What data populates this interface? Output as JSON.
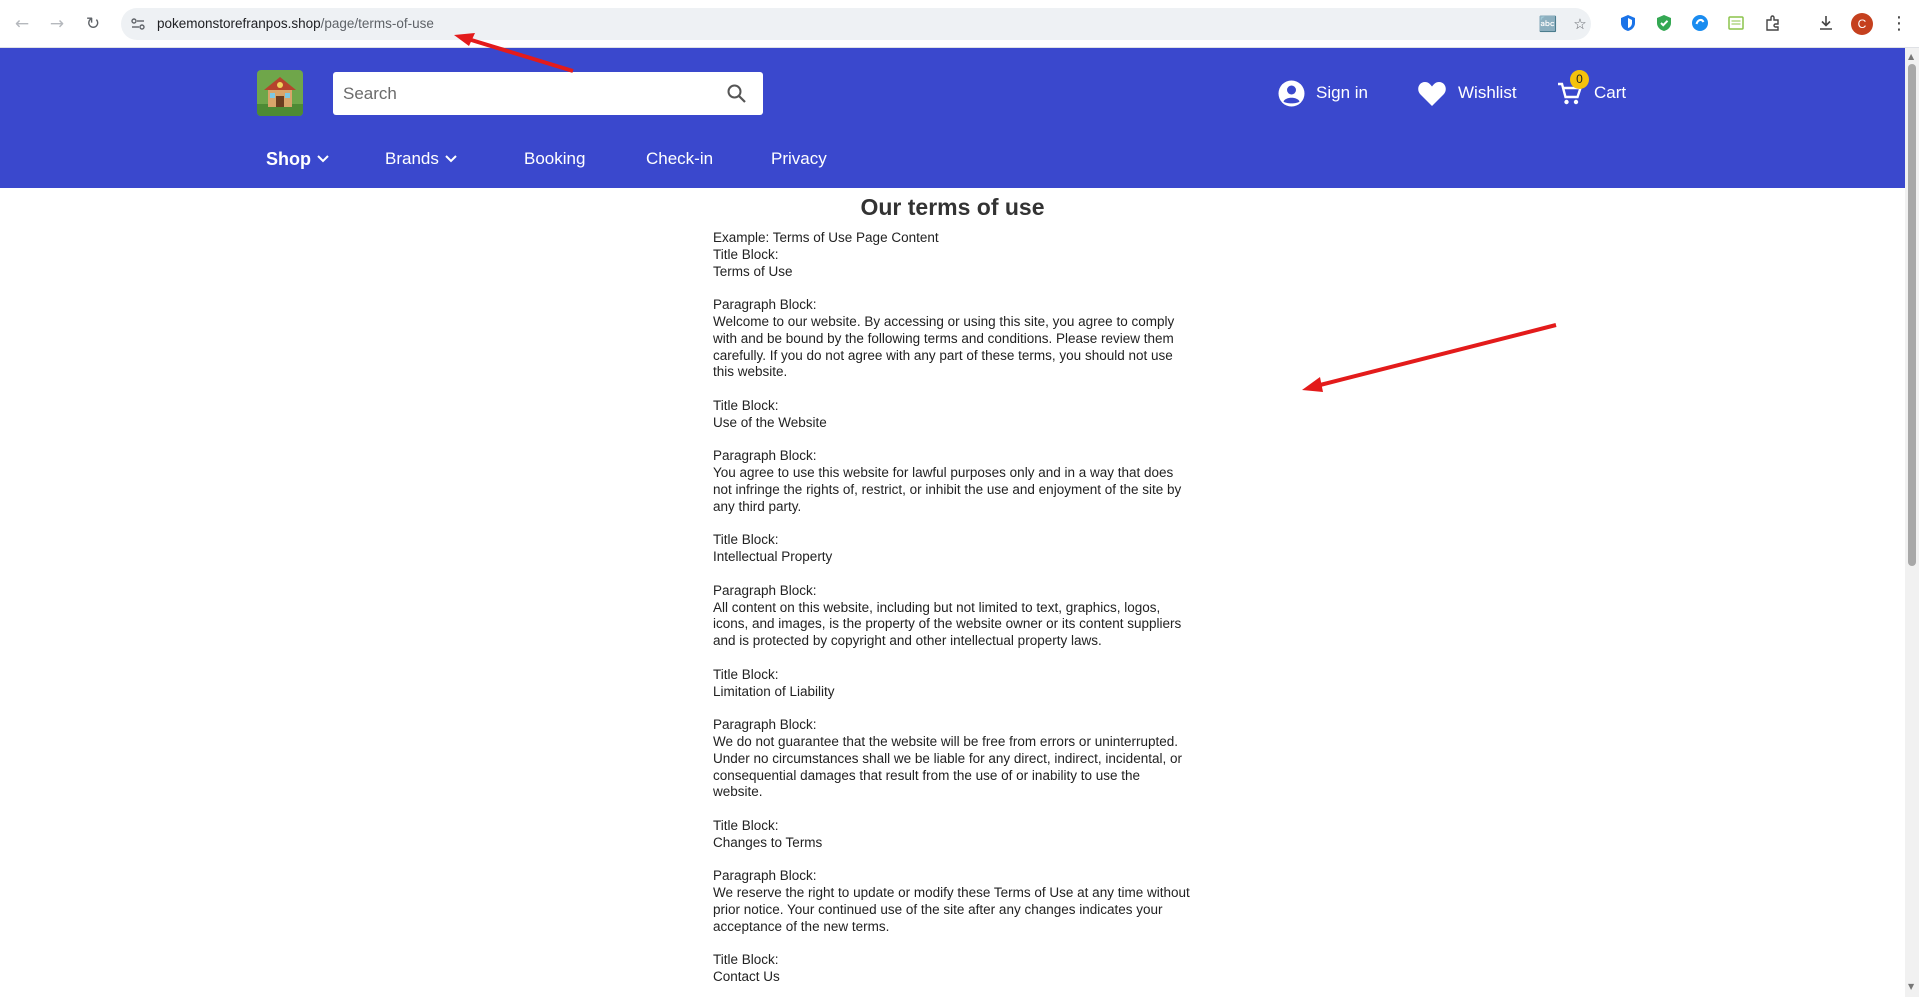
{
  "browser": {
    "url_host": "pokemonstorefranpos.shop",
    "url_path": "/page/terms-of-use",
    "profile_initial": "C",
    "icons": [
      "back-icon",
      "forward-icon",
      "reload-icon",
      "site-info-icon",
      "translate-icon",
      "bookmark-star-icon",
      "extensions-icon",
      "download-icon",
      "menu-icon"
    ]
  },
  "header": {
    "search_placeholder": "Search",
    "sign_in_label": "Sign in",
    "wishlist_label": "Wishlist",
    "cart_label": "Cart",
    "cart_count": "0",
    "brand_color": "#3a48cd"
  },
  "nav": {
    "shop": "Shop",
    "brands": "Brands",
    "booking": "Booking",
    "checkin": "Check-in",
    "privacy": "Privacy"
  },
  "page": {
    "title": "Our terms of use",
    "intro": "Example: Terms of Use Page Content",
    "blocks": [
      {
        "label": "Title Block:",
        "text": "Terms of Use"
      },
      {
        "label": "Paragraph Block:",
        "text": "Welcome to our website. By accessing or using this site, you agree to comply with and be bound by the following terms and conditions. Please review them carefully. If you do not agree with any part of these terms, you should not use this website."
      },
      {
        "label": "Title Block:",
        "text": "Use of the Website"
      },
      {
        "label": "Paragraph Block:",
        "text": "You agree to use this website for lawful purposes only and in a way that does not infringe the rights of, restrict, or inhibit the use and enjoyment of the site by any third party."
      },
      {
        "label": "Title Block:",
        "text": "Intellectual Property"
      },
      {
        "label": "Paragraph Block:",
        "text": "All content on this website, including but not limited to text, graphics, logos, icons, and images, is the property of the website owner or its content suppliers and is protected by copyright and other intellectual property laws."
      },
      {
        "label": "Title Block:",
        "text": "Limitation of Liability"
      },
      {
        "label": "Paragraph Block:",
        "text": "We do not guarantee that the website will be free from errors or uninterrupted. Under no circumstances shall we be liable for any direct, indirect, incidental, or consequential damages that result from the use of or inability to use the website."
      },
      {
        "label": "Title Block:",
        "text": "Changes to Terms"
      },
      {
        "label": "Paragraph Block:",
        "text": "We reserve the right to update or modify these Terms of Use at any time without prior notice. Your continued use of the site after any changes indicates your acceptance of the new terms."
      },
      {
        "label": "Title Block:",
        "text": "Contact Us"
      }
    ]
  },
  "annotations": {
    "arrow_color": "#e31b1b"
  }
}
